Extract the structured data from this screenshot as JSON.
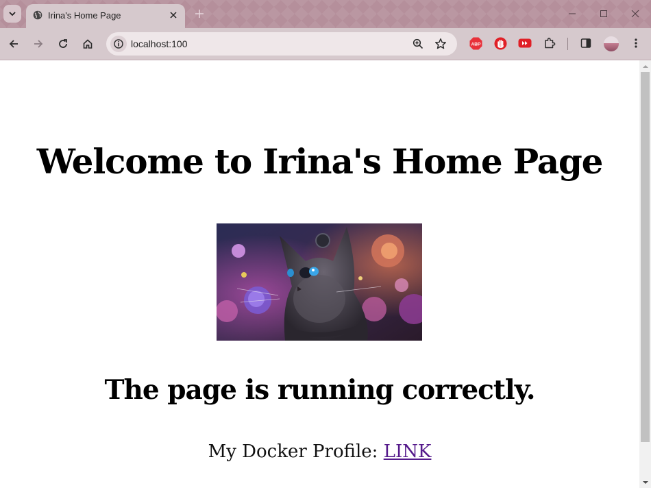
{
  "browser": {
    "tab": {
      "title": "Irina's Home Page"
    },
    "address": {
      "url": "localhost:100"
    },
    "extensions": [
      {
        "name": "adblock-plus",
        "label": "ABP",
        "color": "#e8313a"
      },
      {
        "name": "stop-hand",
        "color": "#e01f26"
      },
      {
        "name": "youtube-skip",
        "color": "#e01f26"
      },
      {
        "name": "extensions-puzzle"
      }
    ],
    "theme": {
      "frame": "#b58f9b",
      "toolbar": "#d6c9cd",
      "omnibox": "#efe7e9"
    }
  },
  "page": {
    "heading": "Welcome to Irina's Home Page",
    "image_alt": "cat among flowers",
    "status": "The page is running correctly.",
    "profile": {
      "label": "My Docker Profile:",
      "link_text": "LINK"
    },
    "link_color": "#551a8b"
  }
}
